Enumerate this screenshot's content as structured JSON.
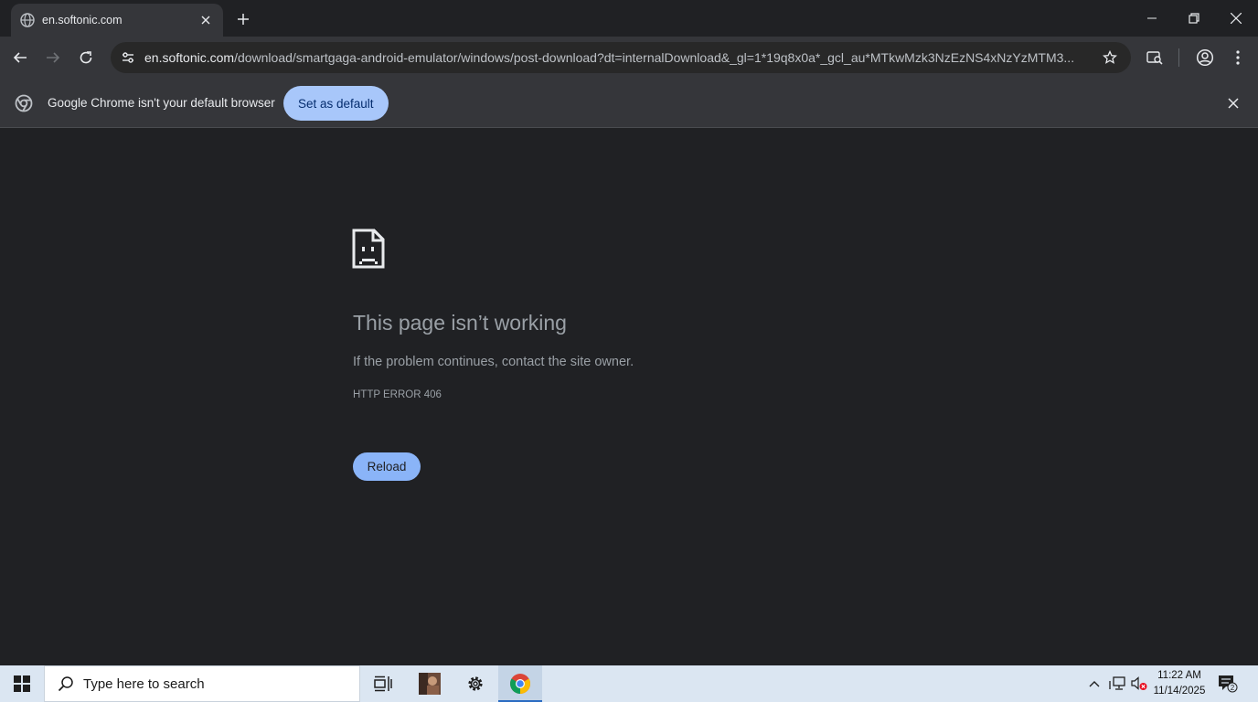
{
  "tab": {
    "title": "en.softonic.com"
  },
  "omnibox": {
    "host": "en.softonic.com",
    "path": "/download/smartgaga-android-emulator/windows/post-download?dt=internalDownload&_gl=1*19q8x0a*_gcl_au*MTkwMzk3NzEzNS4xNzYzMTM3..."
  },
  "infobar": {
    "message": "Google Chrome isn't your default browser",
    "button_label": "Set as default"
  },
  "error": {
    "title": "This page isn’t working",
    "description": "If the problem continues, contact the site owner.",
    "code": "HTTP ERROR 406",
    "reload_label": "Reload"
  },
  "taskbar": {
    "search_placeholder": "Type here to search",
    "time": "11:22 AM",
    "date": "11/14/2025",
    "notification_count": "2"
  },
  "colors": {
    "page_bg": "#202124",
    "accent": "#8ab4f8",
    "infobar_button": "#a8c7fa"
  }
}
